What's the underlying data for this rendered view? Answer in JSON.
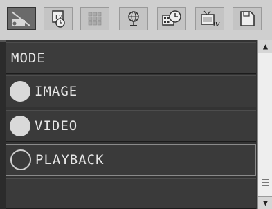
{
  "toolbar": {
    "tabs": [
      {
        "icon": "camera-icon",
        "active": true
      },
      {
        "icon": "date-time-icon",
        "active": false
      },
      {
        "icon": "grid-layout-icon",
        "active": false
      },
      {
        "icon": "globe-icon",
        "active": false
      },
      {
        "icon": "schedule-icon",
        "active": false
      },
      {
        "icon": "tv-output-icon",
        "active": false
      },
      {
        "icon": "memory-card-icon",
        "active": false
      }
    ]
  },
  "menu": {
    "title": "MODE",
    "options": [
      {
        "label": "IMAGE",
        "selected": false
      },
      {
        "label": "VIDEO",
        "selected": false
      },
      {
        "label": "PLAYBACK",
        "selected": true
      }
    ]
  },
  "colors": {
    "toolbar_bg": "#cfcfcf",
    "list_bg": "#3a3a3a",
    "text": "#e6e6e6"
  }
}
